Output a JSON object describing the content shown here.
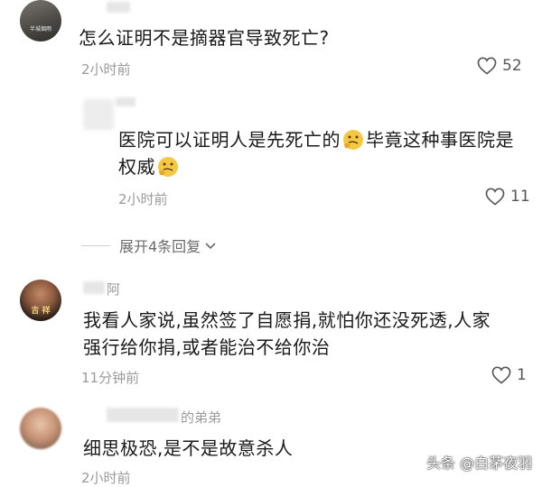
{
  "comments": [
    {
      "text": "怎么证明不是摘器官导致死亡?",
      "time": "2小时前",
      "likes": "52",
      "avatar_text": "半城烟雨",
      "reply": {
        "text_before": "医院可以证明人是先死亡的",
        "text_middle": "毕竟这种事医院是",
        "text_after": "权威",
        "emoji": "thinking-face",
        "time": "2小时前",
        "likes": "11"
      },
      "expand_label": "展开4条回复"
    },
    {
      "username": "阿",
      "avatar_text": "吉 祥",
      "text_line1": "我看人家说,虽然签了自愿捐,就怕你还没死透,人家",
      "text_line2": "强行给你捐,或者能治不给你治",
      "time": "11分钟前",
      "likes": "1"
    },
    {
      "username": "的弟弟",
      "text": "细思极恐,是不是故意杀人",
      "time": "2小时前"
    }
  ],
  "watermark": "头条 @白茅夜羽",
  "colors": {
    "like_icon": "#555555",
    "time_text": "#9a9a9a",
    "emoji": "#f5c842"
  }
}
